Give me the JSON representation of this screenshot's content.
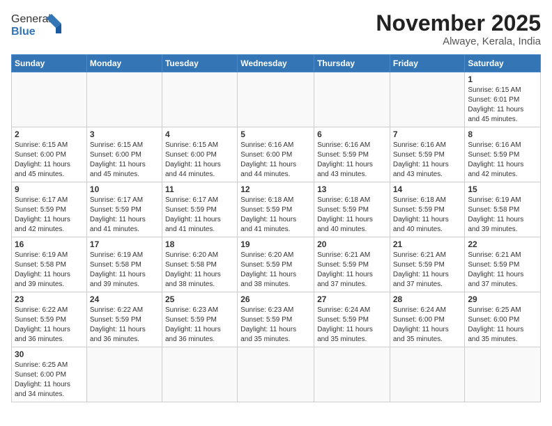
{
  "header": {
    "logo_text_general": "General",
    "logo_text_blue": "Blue",
    "month_title": "November 2025",
    "location": "Alwaye, Kerala, India"
  },
  "weekdays": [
    "Sunday",
    "Monday",
    "Tuesday",
    "Wednesday",
    "Thursday",
    "Friday",
    "Saturday"
  ],
  "weeks": [
    [
      {
        "day": "",
        "info": ""
      },
      {
        "day": "",
        "info": ""
      },
      {
        "day": "",
        "info": ""
      },
      {
        "day": "",
        "info": ""
      },
      {
        "day": "",
        "info": ""
      },
      {
        "day": "",
        "info": ""
      },
      {
        "day": "1",
        "info": "Sunrise: 6:15 AM\nSunset: 6:01 PM\nDaylight: 11 hours\nand 45 minutes."
      }
    ],
    [
      {
        "day": "2",
        "info": "Sunrise: 6:15 AM\nSunset: 6:00 PM\nDaylight: 11 hours\nand 45 minutes."
      },
      {
        "day": "3",
        "info": "Sunrise: 6:15 AM\nSunset: 6:00 PM\nDaylight: 11 hours\nand 45 minutes."
      },
      {
        "day": "4",
        "info": "Sunrise: 6:15 AM\nSunset: 6:00 PM\nDaylight: 11 hours\nand 44 minutes."
      },
      {
        "day": "5",
        "info": "Sunrise: 6:16 AM\nSunset: 6:00 PM\nDaylight: 11 hours\nand 44 minutes."
      },
      {
        "day": "6",
        "info": "Sunrise: 6:16 AM\nSunset: 5:59 PM\nDaylight: 11 hours\nand 43 minutes."
      },
      {
        "day": "7",
        "info": "Sunrise: 6:16 AM\nSunset: 5:59 PM\nDaylight: 11 hours\nand 43 minutes."
      },
      {
        "day": "8",
        "info": "Sunrise: 6:16 AM\nSunset: 5:59 PM\nDaylight: 11 hours\nand 42 minutes."
      }
    ],
    [
      {
        "day": "9",
        "info": "Sunrise: 6:17 AM\nSunset: 5:59 PM\nDaylight: 11 hours\nand 42 minutes."
      },
      {
        "day": "10",
        "info": "Sunrise: 6:17 AM\nSunset: 5:59 PM\nDaylight: 11 hours\nand 41 minutes."
      },
      {
        "day": "11",
        "info": "Sunrise: 6:17 AM\nSunset: 5:59 PM\nDaylight: 11 hours\nand 41 minutes."
      },
      {
        "day": "12",
        "info": "Sunrise: 6:18 AM\nSunset: 5:59 PM\nDaylight: 11 hours\nand 41 minutes."
      },
      {
        "day": "13",
        "info": "Sunrise: 6:18 AM\nSunset: 5:59 PM\nDaylight: 11 hours\nand 40 minutes."
      },
      {
        "day": "14",
        "info": "Sunrise: 6:18 AM\nSunset: 5:59 PM\nDaylight: 11 hours\nand 40 minutes."
      },
      {
        "day": "15",
        "info": "Sunrise: 6:19 AM\nSunset: 5:58 PM\nDaylight: 11 hours\nand 39 minutes."
      }
    ],
    [
      {
        "day": "16",
        "info": "Sunrise: 6:19 AM\nSunset: 5:58 PM\nDaylight: 11 hours\nand 39 minutes."
      },
      {
        "day": "17",
        "info": "Sunrise: 6:19 AM\nSunset: 5:58 PM\nDaylight: 11 hours\nand 39 minutes."
      },
      {
        "day": "18",
        "info": "Sunrise: 6:20 AM\nSunset: 5:58 PM\nDaylight: 11 hours\nand 38 minutes."
      },
      {
        "day": "19",
        "info": "Sunrise: 6:20 AM\nSunset: 5:59 PM\nDaylight: 11 hours\nand 38 minutes."
      },
      {
        "day": "20",
        "info": "Sunrise: 6:21 AM\nSunset: 5:59 PM\nDaylight: 11 hours\nand 37 minutes."
      },
      {
        "day": "21",
        "info": "Sunrise: 6:21 AM\nSunset: 5:59 PM\nDaylight: 11 hours\nand 37 minutes."
      },
      {
        "day": "22",
        "info": "Sunrise: 6:21 AM\nSunset: 5:59 PM\nDaylight: 11 hours\nand 37 minutes."
      }
    ],
    [
      {
        "day": "23",
        "info": "Sunrise: 6:22 AM\nSunset: 5:59 PM\nDaylight: 11 hours\nand 36 minutes."
      },
      {
        "day": "24",
        "info": "Sunrise: 6:22 AM\nSunset: 5:59 PM\nDaylight: 11 hours\nand 36 minutes."
      },
      {
        "day": "25",
        "info": "Sunrise: 6:23 AM\nSunset: 5:59 PM\nDaylight: 11 hours\nand 36 minutes."
      },
      {
        "day": "26",
        "info": "Sunrise: 6:23 AM\nSunset: 5:59 PM\nDaylight: 11 hours\nand 35 minutes."
      },
      {
        "day": "27",
        "info": "Sunrise: 6:24 AM\nSunset: 5:59 PM\nDaylight: 11 hours\nand 35 minutes."
      },
      {
        "day": "28",
        "info": "Sunrise: 6:24 AM\nSunset: 6:00 PM\nDaylight: 11 hours\nand 35 minutes."
      },
      {
        "day": "29",
        "info": "Sunrise: 6:25 AM\nSunset: 6:00 PM\nDaylight: 11 hours\nand 35 minutes."
      }
    ],
    [
      {
        "day": "30",
        "info": "Sunrise: 6:25 AM\nSunset: 6:00 PM\nDaylight: 11 hours\nand 34 minutes."
      },
      {
        "day": "",
        "info": ""
      },
      {
        "day": "",
        "info": ""
      },
      {
        "day": "",
        "info": ""
      },
      {
        "day": "",
        "info": ""
      },
      {
        "day": "",
        "info": ""
      },
      {
        "day": "",
        "info": ""
      }
    ]
  ]
}
